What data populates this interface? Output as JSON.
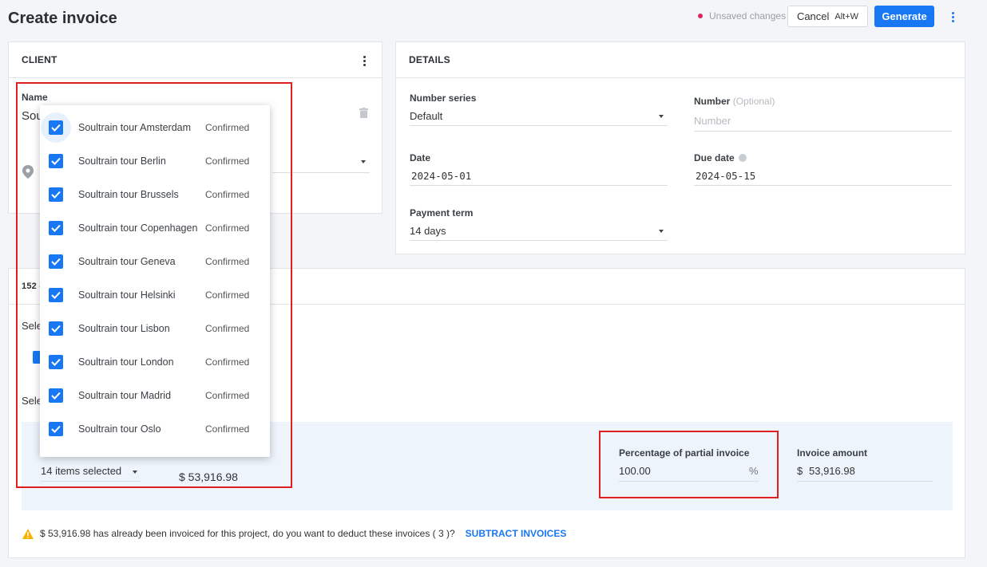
{
  "header": {
    "title": "Create invoice",
    "unsaved_label": "Unsaved changes",
    "cancel_label": "Cancel",
    "cancel_shortcut": "Alt+W",
    "generate_label": "Generate"
  },
  "client": {
    "header": "CLIENT",
    "name_label": "Name",
    "name_value_partial": "Sou"
  },
  "details": {
    "header": "DETAILS",
    "number_series_label": "Number series",
    "number_series_value": "Default",
    "number_label": "Number",
    "number_optional": "(Optional)",
    "number_placeholder": "Number",
    "date_label": "Date",
    "date_value": "2024-05-01",
    "due_date_label": "Due date",
    "due_date_value": "2024-05-15",
    "payment_term_label": "Payment term",
    "payment_term_value": "14 days"
  },
  "lines": {
    "header_partial": "152 -",
    "select_label_1": "Sele",
    "select_label_2": "Sele",
    "items_selected": "14 items selected",
    "subtotal": "$ 53,916.98",
    "percentage_label": "Percentage of partial invoice",
    "percentage_value": "100.00",
    "percentage_unit": "%",
    "invoice_amount_label": "Invoice amount",
    "invoice_amount_currency": "$",
    "invoice_amount_value": "53,916.98"
  },
  "warning": {
    "text": "$ 53,916.98 has already been invoiced for this project, do you want to deduct these invoices ( 3 )?",
    "action": "SUBTRACT INVOICES"
  },
  "dropdown": {
    "items": [
      {
        "name": "Soultrain tour Amsterdam",
        "status": "Confirmed",
        "checked": true
      },
      {
        "name": "Soultrain tour Berlin",
        "status": "Confirmed",
        "checked": true
      },
      {
        "name": "Soultrain tour Brussels",
        "status": "Confirmed",
        "checked": true
      },
      {
        "name": "Soultrain tour Copenhagen",
        "status": "Confirmed",
        "checked": true
      },
      {
        "name": "Soultrain tour Geneva",
        "status": "Confirmed",
        "checked": true
      },
      {
        "name": "Soultrain tour Helsinki",
        "status": "Confirmed",
        "checked": true
      },
      {
        "name": "Soultrain tour Lisbon",
        "status": "Confirmed",
        "checked": true
      },
      {
        "name": "Soultrain tour London",
        "status": "Confirmed",
        "checked": true
      },
      {
        "name": "Soultrain tour Madrid",
        "status": "Confirmed",
        "checked": true
      },
      {
        "name": "Soultrain tour Oslo",
        "status": "Confirmed",
        "checked": true
      }
    ]
  },
  "colors": {
    "primary": "#1877f2",
    "unsaved_dot": "#e0245e",
    "highlight_box": "#e01e1e",
    "warning": "#f5b400"
  }
}
